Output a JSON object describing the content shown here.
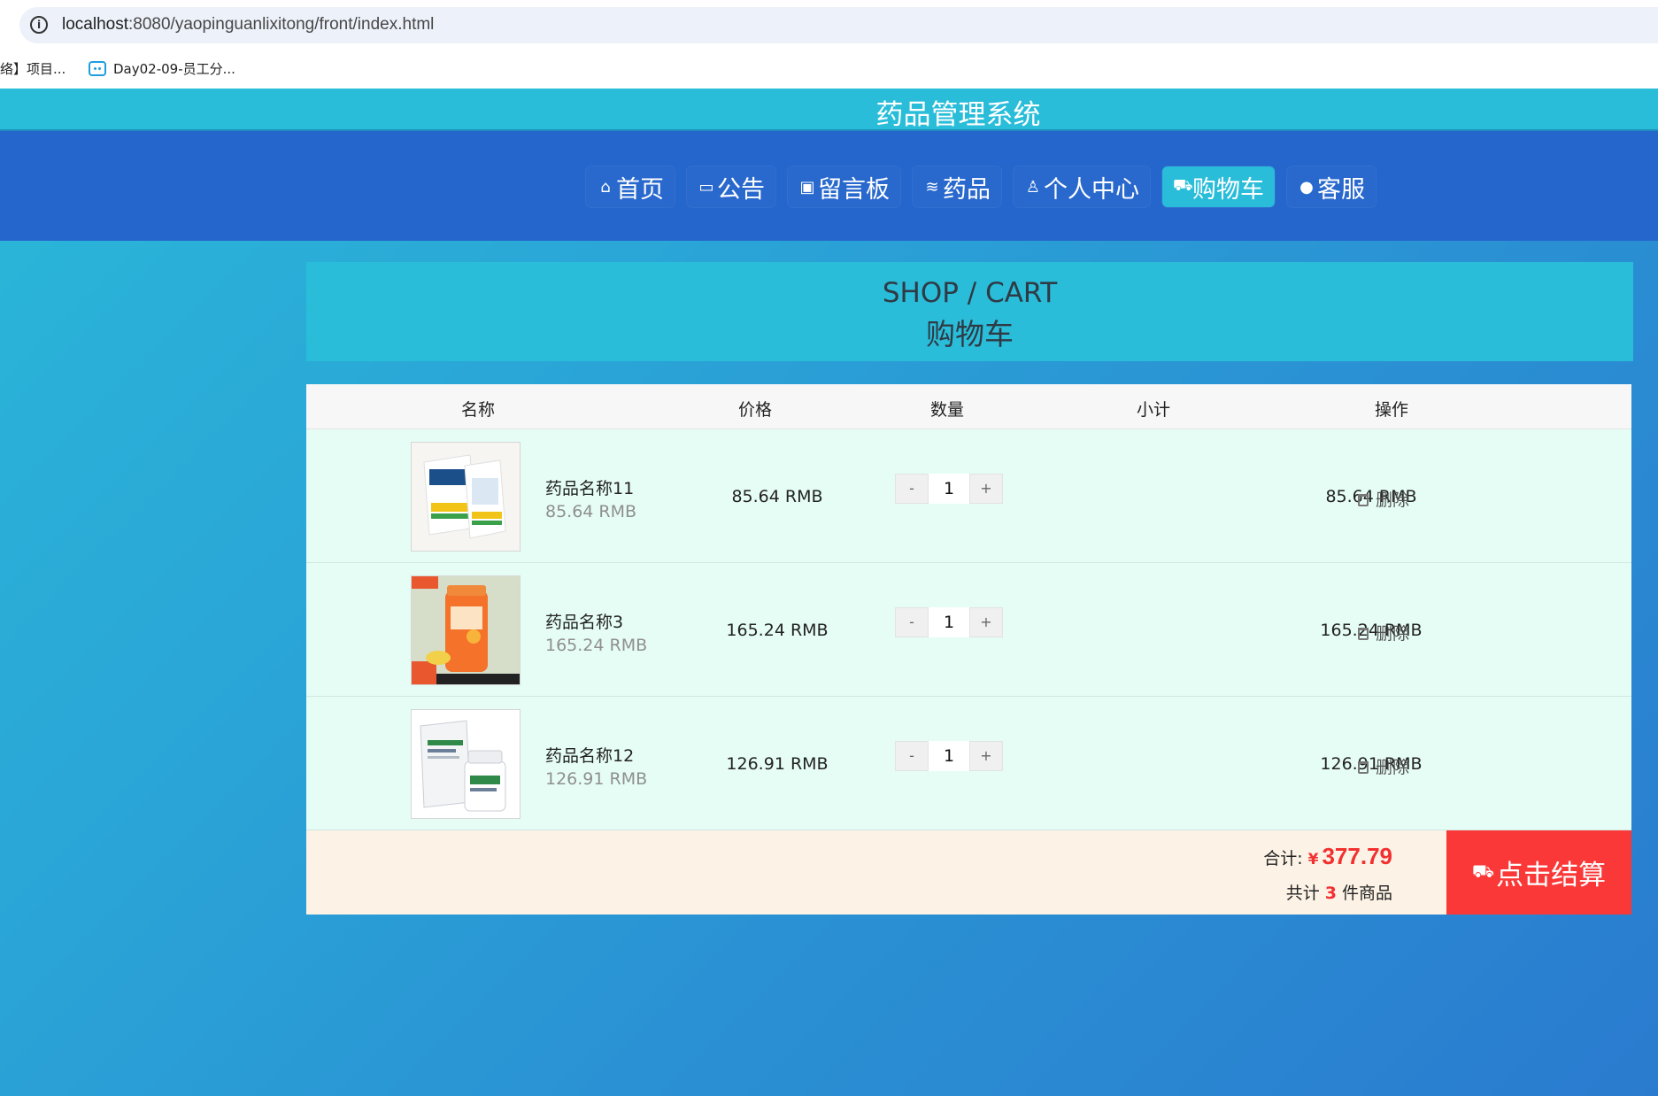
{
  "browser": {
    "url_host": "localhost",
    "url_path": ":8080/yaopinguanlixitong/front/index.html",
    "info_icon": "i",
    "bookmarks": [
      {
        "label": "络】项目..."
      },
      {
        "label": "Day02-09-员工分..."
      }
    ]
  },
  "site": {
    "title": "药品管理系统"
  },
  "nav": [
    {
      "label": "首页",
      "icon": "home-icon",
      "glyph": "⌂",
      "active": false
    },
    {
      "label": "公告",
      "icon": "notice-icon",
      "glyph": "▭",
      "active": false
    },
    {
      "label": "留言板",
      "icon": "gift-icon",
      "glyph": "▣",
      "active": false
    },
    {
      "label": "药品",
      "icon": "layers-icon",
      "glyph": "≋",
      "active": false
    },
    {
      "label": "个人中心",
      "icon": "user-icon",
      "glyph": "♙",
      "active": false
    },
    {
      "label": "购物车",
      "icon": "cart-icon",
      "glyph": "⛟",
      "active": true
    },
    {
      "label": "客服",
      "icon": "wechat-icon",
      "glyph": "●",
      "active": false
    }
  ],
  "cart_header": {
    "en": "SHOP / CART",
    "cn": "购物车"
  },
  "table": {
    "headers": [
      "名称",
      "价格",
      "数量",
      "小计",
      "操作"
    ],
    "rows": [
      {
        "name": "药品名称11",
        "price_sub": "85.64 RMB",
        "price": "85.64 RMB",
        "qty": "1",
        "subtotal": "85.64 RMB",
        "action": "删除"
      },
      {
        "name": "药品名称3",
        "price_sub": "165.24 RMB",
        "price": "165.24 RMB",
        "qty": "1",
        "subtotal": "165.24 RMB",
        "action": "删除"
      },
      {
        "name": "药品名称12",
        "price_sub": "126.91 RMB",
        "price": "126.91 RMB",
        "qty": "1",
        "subtotal": "126.91 RMB",
        "action": "删除"
      }
    ],
    "minus_label": "-",
    "plus_label": "+"
  },
  "footer": {
    "total_label": "合计:",
    "currency": "¥",
    "total_amount": "377.79",
    "count_prefix": "共计",
    "count": "3",
    "count_suffix": "件商品",
    "checkout_label": "点击结算"
  },
  "colors": {
    "accent": "#29bdd9",
    "nav_band": "#2566cc",
    "checkout": "#fb3838",
    "price_red": "#f23030"
  }
}
